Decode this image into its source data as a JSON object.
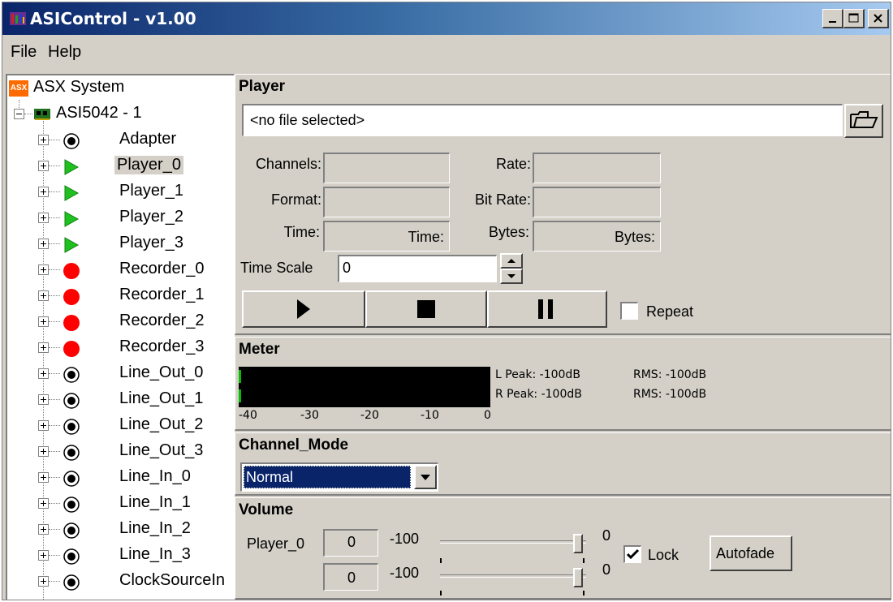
{
  "window": {
    "title": "ASIControl - v1.00"
  },
  "menu": {
    "file": "File",
    "help": "Help"
  },
  "tree": {
    "root_icon_text": "ASX",
    "root": "ASX System",
    "adapter": "ASI5042 - 1",
    "nodes": [
      {
        "label": "Adapter",
        "icon": "circle-dot-icon"
      },
      {
        "label": "Player_0",
        "icon": "play-triangle-icon",
        "selected": true
      },
      {
        "label": "Player_1",
        "icon": "play-triangle-icon"
      },
      {
        "label": "Player_2",
        "icon": "play-triangle-icon"
      },
      {
        "label": "Player_3",
        "icon": "play-triangle-icon"
      },
      {
        "label": "Recorder_0",
        "icon": "red-dot-icon"
      },
      {
        "label": "Recorder_1",
        "icon": "red-dot-icon"
      },
      {
        "label": "Recorder_2",
        "icon": "red-dot-icon"
      },
      {
        "label": "Recorder_3",
        "icon": "red-dot-icon"
      },
      {
        "label": "Line_Out_0",
        "icon": "circle-dot-icon"
      },
      {
        "label": "Line_Out_1",
        "icon": "circle-dot-icon"
      },
      {
        "label": "Line_Out_2",
        "icon": "circle-dot-icon"
      },
      {
        "label": "Line_Out_3",
        "icon": "circle-dot-icon"
      },
      {
        "label": "Line_In_0",
        "icon": "circle-dot-icon"
      },
      {
        "label": "Line_In_1",
        "icon": "circle-dot-icon"
      },
      {
        "label": "Line_In_2",
        "icon": "circle-dot-icon"
      },
      {
        "label": "Line_In_3",
        "icon": "circle-dot-icon"
      },
      {
        "label": "ClockSourceIn",
        "icon": "circle-dot-icon"
      }
    ]
  },
  "player": {
    "title": "Player",
    "file_value": "<no file selected>",
    "channels_label": "Channels:",
    "rate_label": "Rate:",
    "format_label": "Format:",
    "bitrate_label": "Bit Rate:",
    "time_label": "Time:",
    "time_value": "Time:",
    "bytes_label": "Bytes:",
    "bytes_value": "Bytes:",
    "timescale_label": "Time Scale",
    "timescale_value": "0",
    "repeat_label": "Repeat",
    "repeat_checked": false
  },
  "meter": {
    "title": "Meter",
    "l_peak": "L Peak: -100dB",
    "r_peak": "R Peak: -100dB",
    "l_rms": "RMS: -100dB",
    "r_rms": "RMS: -100dB",
    "scale": [
      "-40",
      "-30",
      "-20",
      "-10",
      "0"
    ]
  },
  "channel_mode": {
    "title": "Channel_Mode",
    "selected": "Normal"
  },
  "volume": {
    "title": "Volume",
    "name": "Player_0",
    "left_value": "0",
    "right_value": "0",
    "min_label": "-100",
    "max_label": "0",
    "left_level": 1.0,
    "right_level": 1.0,
    "lock_label": "Lock",
    "lock_checked": true,
    "autofade_label": "Autofade"
  },
  "colors": {
    "title_start": "#0a246a",
    "title_end": "#a6caf0",
    "face": "#d4d0c8",
    "selection": "#0a246a",
    "meter_bg": "#000000",
    "meter_green": "#00c000"
  }
}
